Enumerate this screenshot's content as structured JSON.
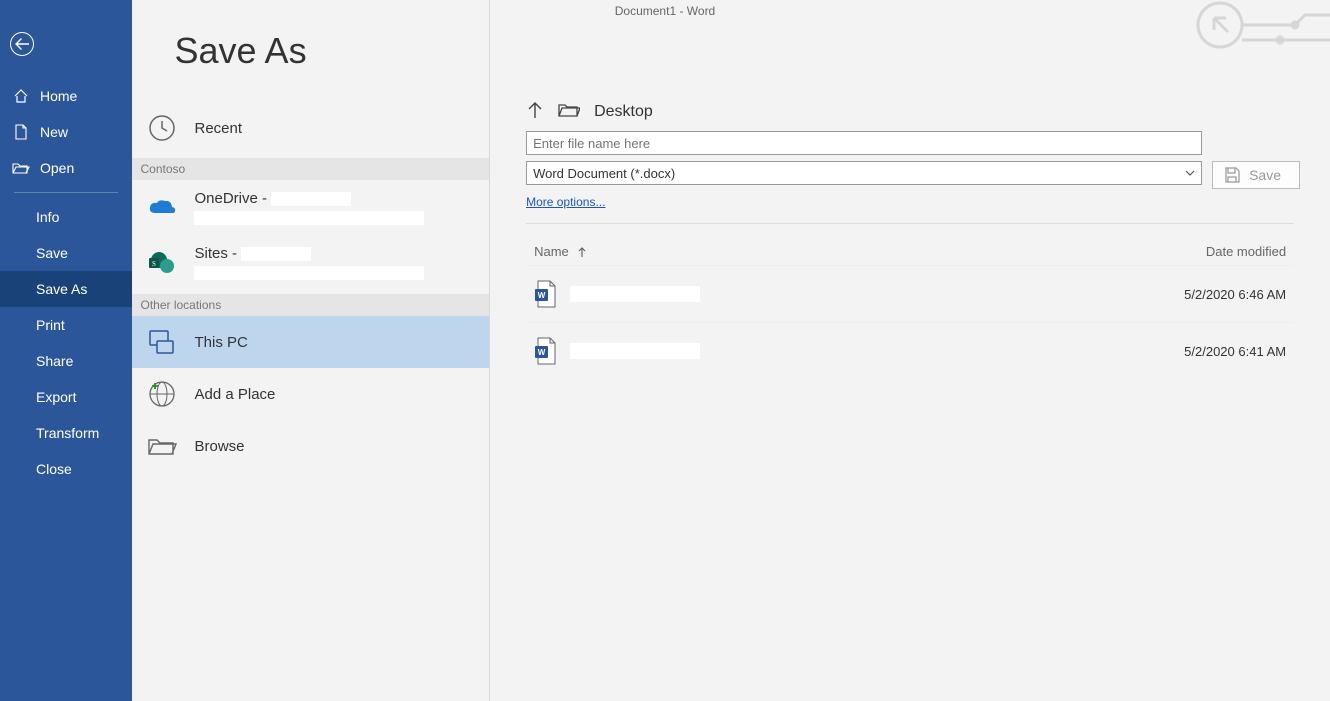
{
  "title": "Document1  -  Word",
  "page_title": "Save As",
  "sidebar_top": [
    {
      "id": "home",
      "label": "Home"
    },
    {
      "id": "new",
      "label": "New"
    },
    {
      "id": "open",
      "label": "Open"
    }
  ],
  "sidebar_bottom": [
    {
      "id": "info",
      "label": "Info"
    },
    {
      "id": "save",
      "label": "Save"
    },
    {
      "id": "saveas",
      "label": "Save As",
      "selected": true
    },
    {
      "id": "print",
      "label": "Print"
    },
    {
      "id": "share",
      "label": "Share"
    },
    {
      "id": "export",
      "label": "Export"
    },
    {
      "id": "transform",
      "label": "Transform"
    },
    {
      "id": "close",
      "label": "Close"
    }
  ],
  "locations": {
    "recent_label": "Recent",
    "group_label": "Contoso",
    "onedrive_label": "OneDrive -",
    "sites_label": "Sites -",
    "other_label": "Other locations",
    "this_pc_label": "This PC",
    "add_place_label": "Add a Place",
    "browse_label": "Browse"
  },
  "browse": {
    "current_folder": "Desktop",
    "filename_placeholder": "Enter file name here",
    "filetype": "Word Document (*.docx)",
    "more_options": "More options...",
    "save_label": "Save",
    "columns": {
      "name": "Name",
      "modified": "Date modified"
    },
    "files": [
      {
        "name": "",
        "modified": "5/2/2020 6:46 AM"
      },
      {
        "name": "",
        "modified": "5/2/2020 6:41 AM"
      }
    ]
  }
}
